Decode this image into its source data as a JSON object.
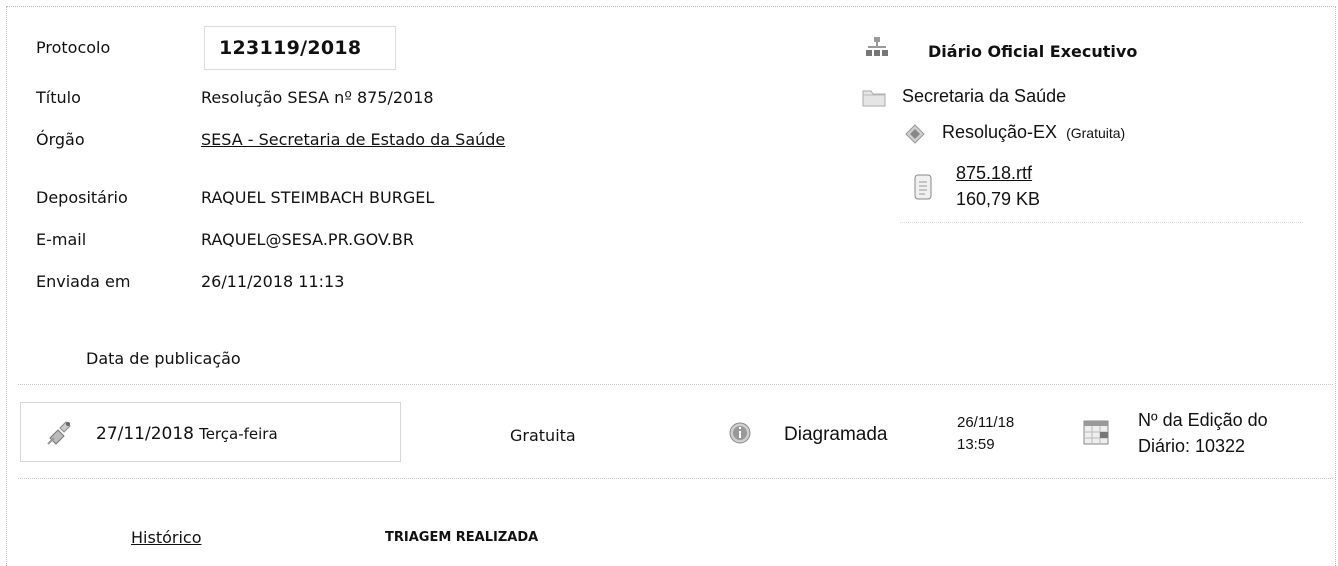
{
  "protocolo": {
    "label": "Protocolo",
    "value": "123119/2018"
  },
  "titulo": {
    "label": "Título",
    "value": "Resolução SESA nº 875/2018"
  },
  "orgao": {
    "label": "Órgão",
    "value": "SESA - Secretaria de Estado da Saúde"
  },
  "depositario": {
    "label": "Depositário",
    "value": "RAQUEL STEIMBACH BURGEL"
  },
  "email": {
    "label": "E-mail",
    "value": "RAQUEL@SESA.PR.GOV.BR"
  },
  "enviada": {
    "label": "Enviada em",
    "value": "26/11/2018 11:13"
  },
  "tree": {
    "root": "Diário Oficial Executivo",
    "folder": "Secretaria da Saúde",
    "item": "Resolução-EX",
    "item_tag": "(Gratuita)",
    "file_name": "875.18.rtf",
    "file_size": "160,79 KB"
  },
  "publicacao": {
    "label": "Data de publicação",
    "date": "27/11/2018",
    "weekday": "Terça-feira",
    "tipo": "Gratuita",
    "status": "Diagramada",
    "status_date": "26/11/18",
    "status_time": "13:59",
    "edicao_line1": "Nº da Edição do",
    "edicao_line2": "Diário: 10322"
  },
  "footer": {
    "historico": "Histórico",
    "triagem": "TRIAGEM REALIZADA"
  }
}
